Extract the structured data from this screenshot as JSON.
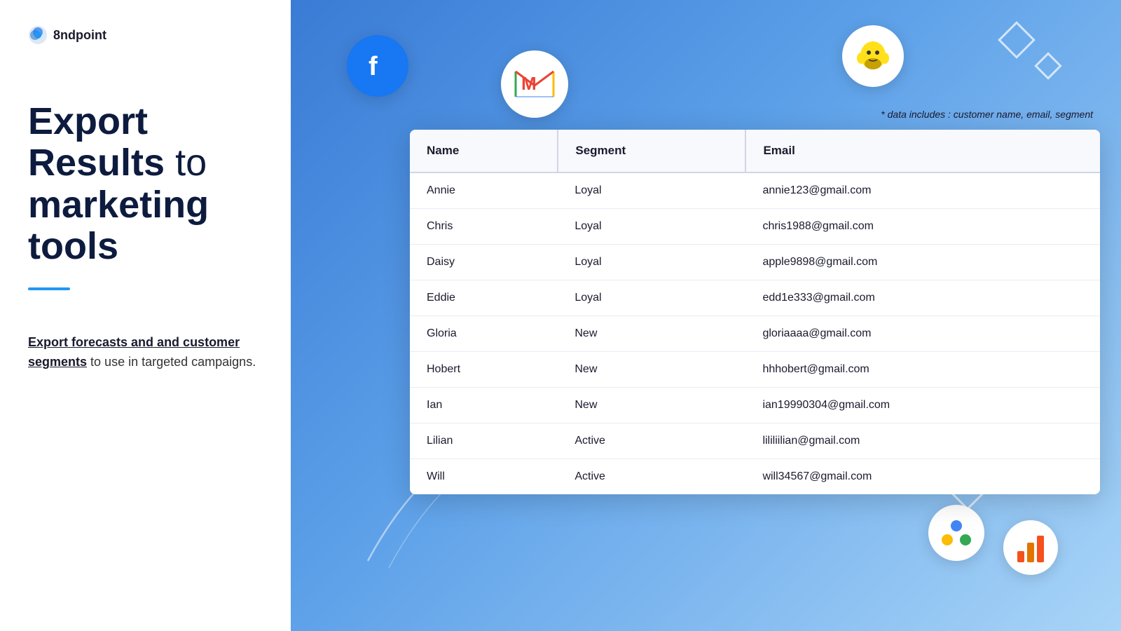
{
  "logo": {
    "text": "8ndpoint"
  },
  "heading": {
    "line1": "Export",
    "line2": "Results",
    "line3": "to",
    "line4": "marketing tools"
  },
  "divider": true,
  "description": {
    "link_text": "Export forecasts and and customer segments",
    "rest": " to use in targeted campaigns."
  },
  "data_note": "* data includes : customer name, email, segment",
  "table": {
    "columns": [
      "Name",
      "Segment",
      "Email"
    ],
    "rows": [
      {
        "name": "Annie",
        "segment": "Loyal",
        "email": "annie123@gmail.com"
      },
      {
        "name": "Chris",
        "segment": "Loyal",
        "email": "chris1988@gmail.com"
      },
      {
        "name": "Daisy",
        "segment": "Loyal",
        "email": "apple9898@gmail.com"
      },
      {
        "name": "Eddie",
        "segment": "Loyal",
        "email": "edd1e333@gmail.com"
      },
      {
        "name": "Gloria",
        "segment": "New",
        "email": "gloriaaaa@gmail.com"
      },
      {
        "name": "Hobert",
        "segment": "New",
        "email": "hhhobert@gmail.com"
      },
      {
        "name": "Ian",
        "segment": "New",
        "email": "ian19990304@gmail.com"
      },
      {
        "name": "Lilian",
        "segment": "Active",
        "email": "lililiilian@gmail.com"
      },
      {
        "name": "Will",
        "segment": "Active",
        "email": "will34567@gmail.com"
      }
    ]
  },
  "platforms": {
    "facebook": "Facebook",
    "gmail": "Gmail",
    "mailchimp": "Mailchimp",
    "google_ads": "Google Ads",
    "analytics": "Google Analytics"
  }
}
